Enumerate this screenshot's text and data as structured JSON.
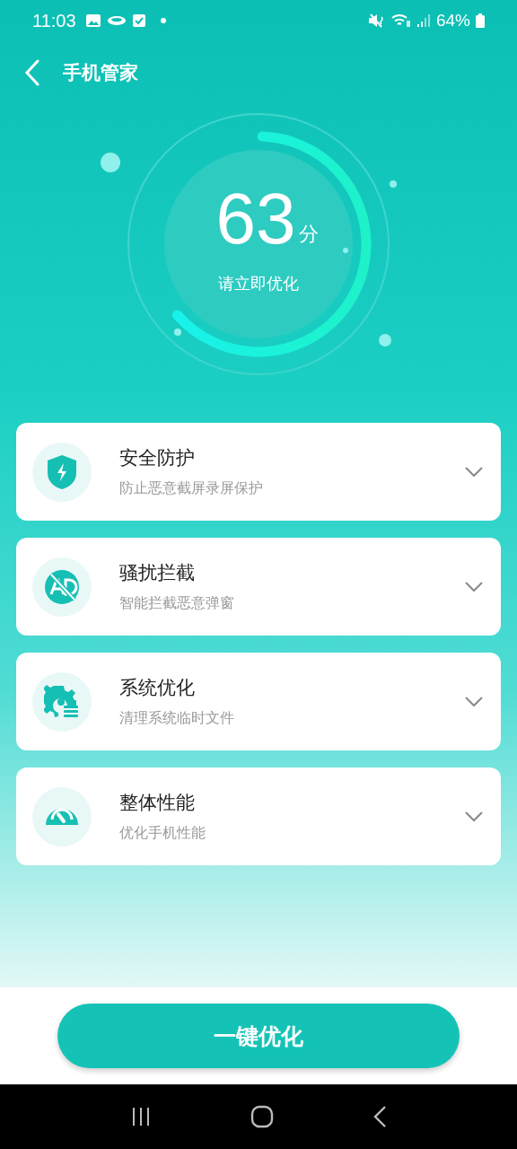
{
  "status_bar": {
    "time": "11:03",
    "battery": "64%"
  },
  "header": {
    "title": "手机管家"
  },
  "score": {
    "value": "63",
    "unit": "分",
    "hint": "请立即优化",
    "level": 0.63
  },
  "features": [
    {
      "kind": "shield",
      "title": "安全防护",
      "subtitle": "防止恶意截屏录屏保护"
    },
    {
      "kind": "ad_block",
      "title": "骚扰拦截",
      "subtitle": "智能拦截恶意弹窗"
    },
    {
      "kind": "gear",
      "title": "系统优化",
      "subtitle": "清理系统临时文件"
    },
    {
      "kind": "gauge",
      "title": "整体性能",
      "subtitle": "优化手机性能"
    }
  ],
  "primary_button": "一键优化"
}
